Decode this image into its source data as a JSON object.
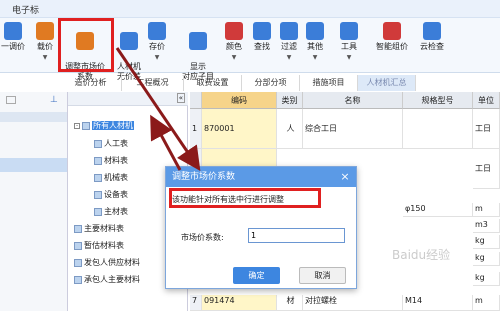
{
  "app": {
    "title": "电子标"
  },
  "ribbon": {
    "items": [
      {
        "label": "一调价",
        "icon": "adjust-price-icon",
        "color": "#3b7dd8"
      },
      {
        "label": "载价",
        "icon": "load-price-icon",
        "color": "#e07a22"
      },
      {
        "label": "调整市场价\n系数",
        "icon": "market-coef-icon",
        "color": "#e07a22"
      },
      {
        "label": "人材机\n无价差",
        "icon": "no-diff-icon",
        "color": "#3b7dd8"
      },
      {
        "label": "存价",
        "icon": "save-price-icon",
        "color": "#3b7dd8"
      },
      {
        "label": "显示\n对应子目",
        "icon": "show-sub-icon",
        "color": "#3b7dd8"
      },
      {
        "label": "颜色",
        "icon": "color-icon",
        "color": "#d03a3a"
      },
      {
        "label": "查找",
        "icon": "find-icon",
        "color": "#3b7dd8"
      },
      {
        "label": "过滤",
        "icon": "filter-icon",
        "color": "#3b7dd8"
      },
      {
        "label": "其他",
        "icon": "other-icon",
        "color": "#3b7dd8"
      },
      {
        "label": "工具",
        "icon": "tool-icon",
        "color": "#3b7dd8"
      },
      {
        "label": "智能组价",
        "icon": "smart-price-icon",
        "color": "#d03a3a"
      },
      {
        "label": "云检查",
        "icon": "cloud-check-icon",
        "color": "#3b7dd8"
      }
    ]
  },
  "tabs": [
    "造价分析",
    "工程概况",
    "取费设置",
    "分部分项",
    "措施项目",
    "人材机汇总"
  ],
  "tree": {
    "collapse_label": "«",
    "nodes": [
      {
        "label": "所有人材机",
        "level": 0
      },
      {
        "label": "人工表",
        "level": 1
      },
      {
        "label": "材料表",
        "level": 1
      },
      {
        "label": "机械表",
        "level": 1
      },
      {
        "label": "设备表",
        "level": 1
      },
      {
        "label": "主材表",
        "level": 1
      },
      {
        "label": "主要材料表",
        "level": 0
      },
      {
        "label": "暂估材料表",
        "level": 0
      },
      {
        "label": "发包人供应材料",
        "level": 0
      },
      {
        "label": "承包人主要材料",
        "level": 0
      }
    ]
  },
  "grid": {
    "headers": [
      "",
      "编码",
      "类别",
      "名称",
      "规格型号",
      "单位"
    ],
    "rows": [
      {
        "idx": "1",
        "code": "870001",
        "cat": "人",
        "name": "综合工日",
        "spec": "",
        "unit": "工日"
      },
      {
        "idx": "",
        "code": "",
        "cat": "",
        "name": "",
        "spec": "",
        "unit": "工日"
      },
      {
        "idx": "",
        "code": "",
        "cat": "",
        "name": "",
        "spec": "φ150",
        "unit": "m"
      },
      {
        "idx": "",
        "code": "",
        "cat": "",
        "name": "",
        "spec": "",
        "unit": "m3"
      },
      {
        "idx": "",
        "code": "",
        "cat": "",
        "name": "",
        "spec": "",
        "unit": "kg"
      },
      {
        "idx": "",
        "code": "",
        "cat": "",
        "name": "",
        "spec": "",
        "unit": "kg"
      },
      {
        "idx": "",
        "code": "",
        "cat": "",
        "name": "",
        "spec": "",
        "unit": "kg"
      },
      {
        "idx": "7",
        "code": "091474",
        "cat": "材",
        "name": "对拉螺栓",
        "spec": "M14",
        "unit": "m"
      }
    ]
  },
  "dialog": {
    "title": "调整市场价系数",
    "close": "×",
    "note": "该功能针对所有选中行进行调整",
    "field_label": "市场价系数:",
    "field_value": "1",
    "ok": "确定",
    "cancel": "取消"
  },
  "watermark": "Baidu经验"
}
